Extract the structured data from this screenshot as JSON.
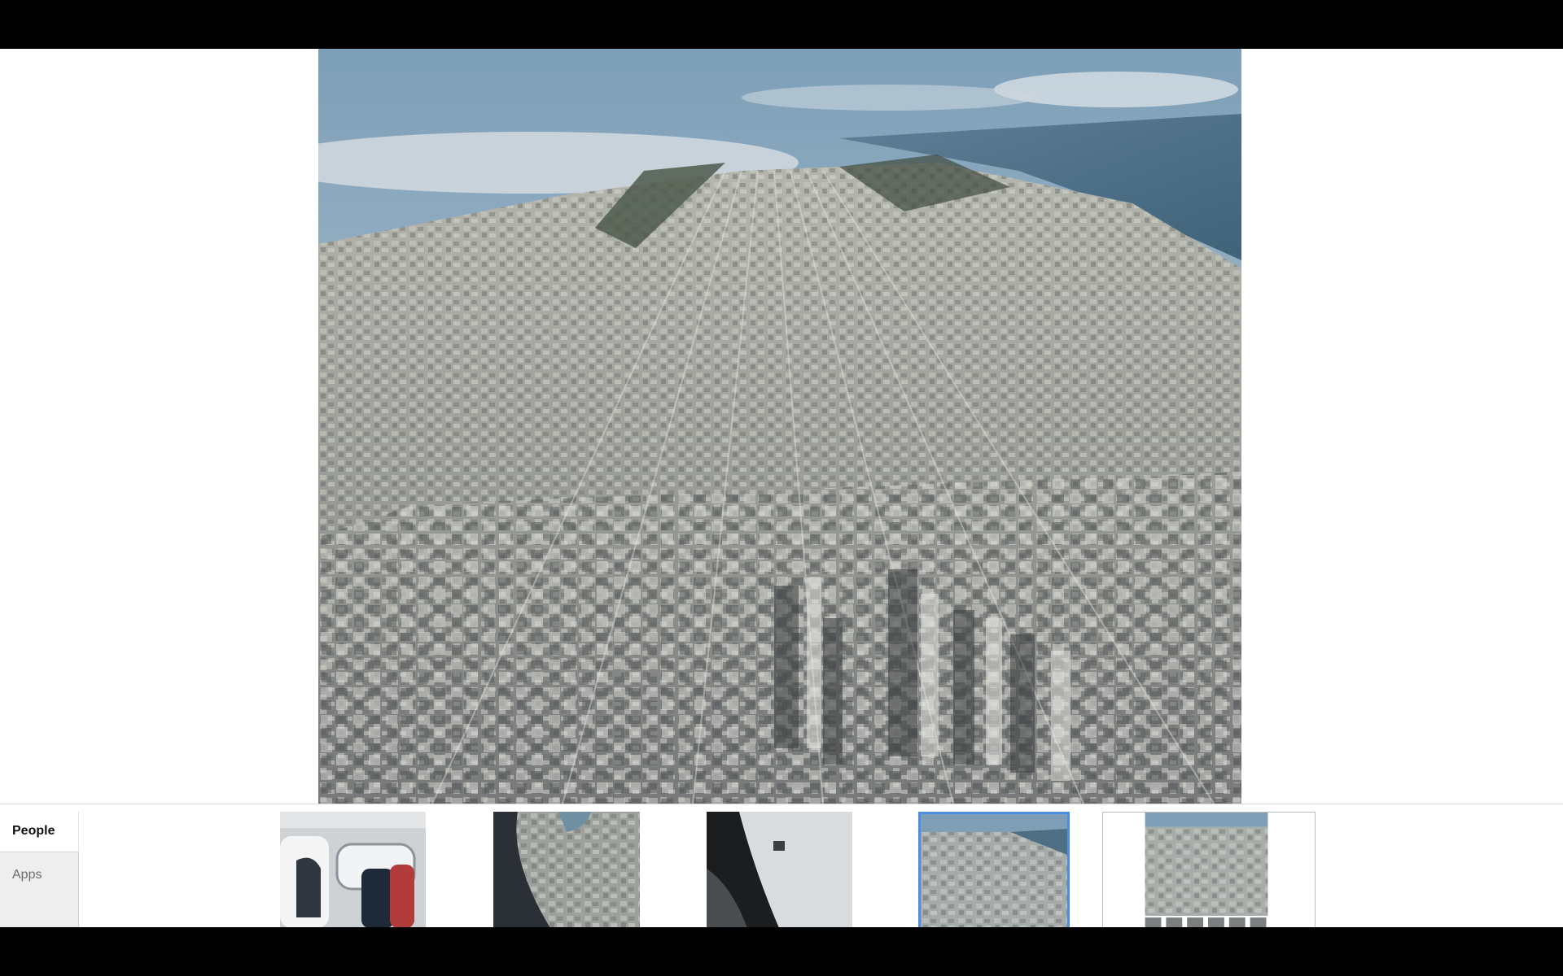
{
  "viewer": {
    "main_photo": {
      "subject": "aerial-city-view"
    }
  },
  "side_tabs": [
    {
      "label": "People",
      "active": true
    },
    {
      "label": "Apps",
      "active": false
    }
  ],
  "thumbnails": [
    {
      "subject": "plane-cabin-interior",
      "selected": false
    },
    {
      "subject": "city-through-plane-window",
      "selected": false
    },
    {
      "subject": "plane-exterior-door",
      "selected": false
    },
    {
      "subject": "aerial-city-view",
      "selected": true
    },
    {
      "subject": "aerial-city-view-with-strip",
      "selected": false
    }
  ],
  "colors": {
    "selection_accent": "#4a8fe0",
    "letterbox": "#000000"
  }
}
